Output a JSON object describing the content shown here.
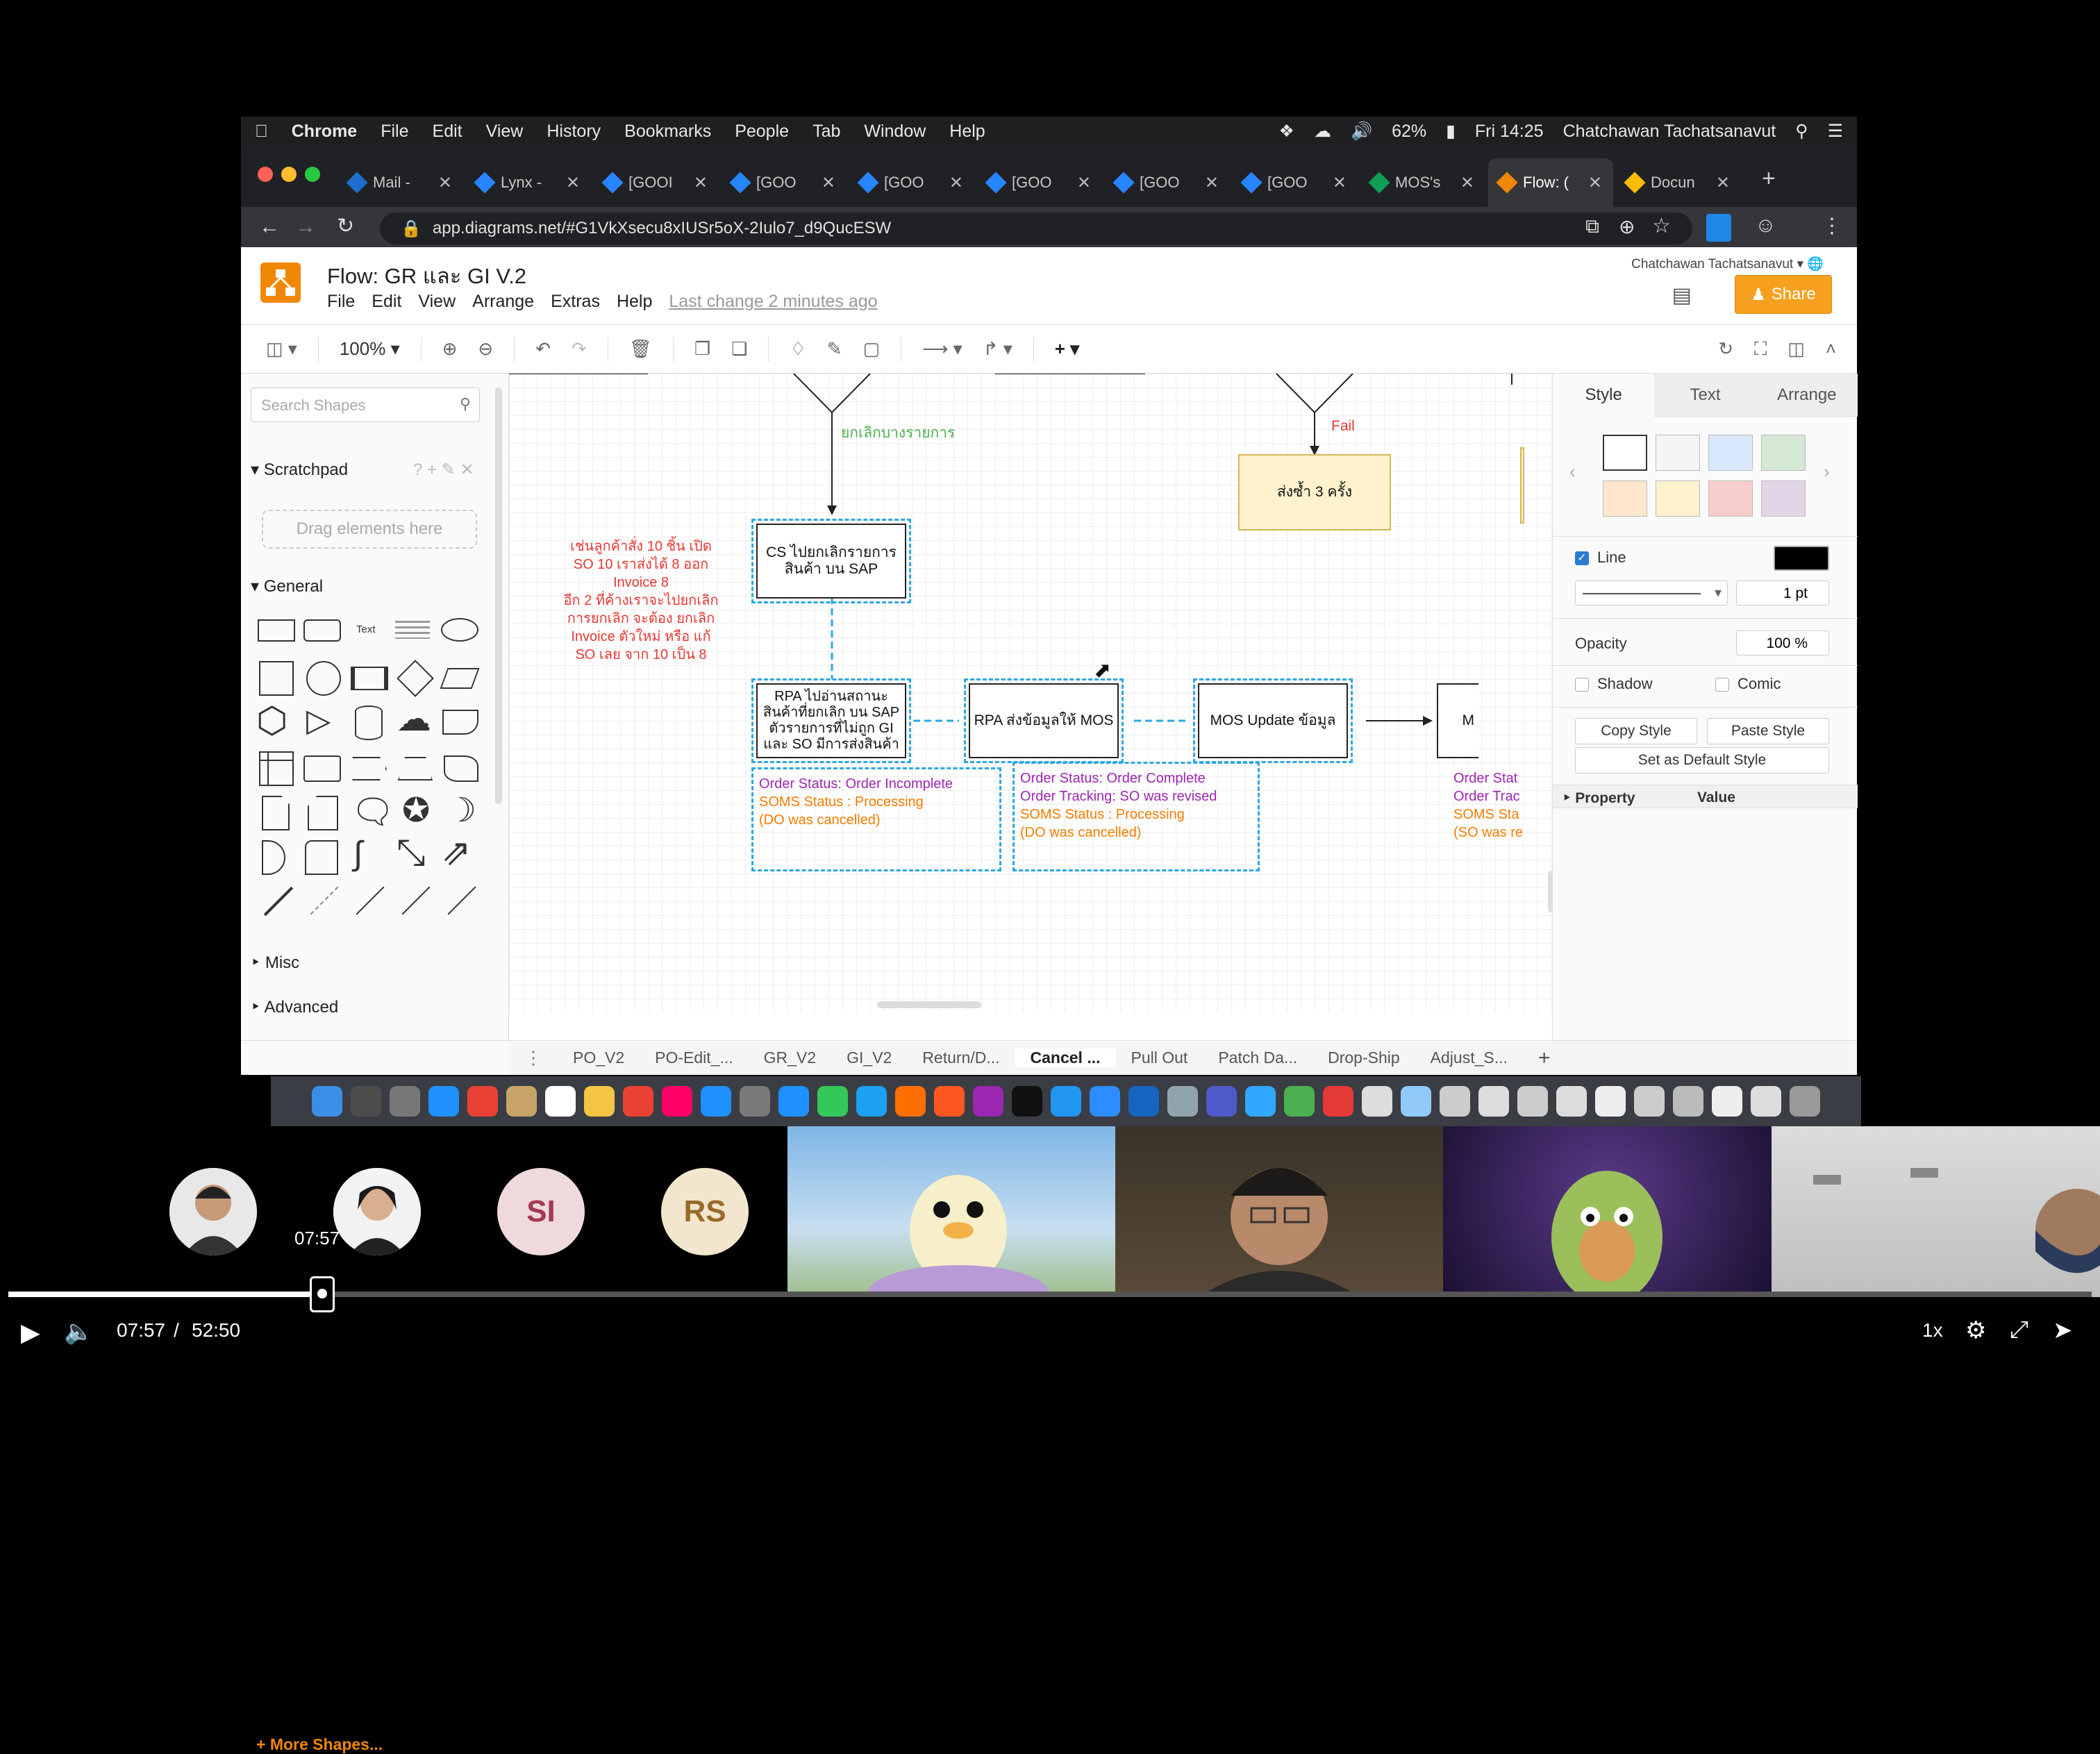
{
  "macbar": {
    "app": "Chrome",
    "menus": [
      "File",
      "Edit",
      "View",
      "History",
      "Bookmarks",
      "People",
      "Tab",
      "Window",
      "Help"
    ],
    "battery": "62%",
    "clock": "Fri 14:25",
    "user": "Chatchawan Tachatsanavut"
  },
  "browser": {
    "tabs": [
      {
        "label": "Mail - ",
        "icon": "outlook-icon",
        "color": "#1e6ecb"
      },
      {
        "label": "Lynx -",
        "icon": "jira-icon",
        "color": "#2684ff"
      },
      {
        "label": "[GOOI",
        "icon": "jira-icon",
        "color": "#2684ff"
      },
      {
        "label": "[GOO",
        "icon": "jira-icon",
        "color": "#2684ff"
      },
      {
        "label": "[GOO",
        "icon": "jira-icon",
        "color": "#2684ff"
      },
      {
        "label": "[GOO",
        "icon": "jira-icon",
        "color": "#2684ff"
      },
      {
        "label": "[GOO",
        "icon": "jira-icon",
        "color": "#2684ff"
      },
      {
        "label": "[GOO",
        "icon": "jira-icon",
        "color": "#2684ff"
      },
      {
        "label": "MOS's",
        "icon": "sheets-icon",
        "color": "#0f9d58"
      },
      {
        "label": "Flow: (",
        "icon": "drawio-icon",
        "color": "#f08705"
      },
      {
        "label": "Docun",
        "icon": "drive-icon",
        "color": "#fbbc04"
      }
    ],
    "active_tab_index": 9,
    "url": "app.diagrams.net/#G1VkXsecu8xIUSr5oX-2Iulo7_d9QucESW"
  },
  "app": {
    "title": "Flow: GR และ GI V.2",
    "menu": [
      "File",
      "Edit",
      "View",
      "Arrange",
      "Extras",
      "Help"
    ],
    "last_change": "Last change 2 minutes ago",
    "user": "Chatchawan Tachatsanavut",
    "share_label": "Share",
    "zoom": "100%"
  },
  "sidebar": {
    "search_placeholder": "Search Shapes",
    "scratchpad": "Scratchpad",
    "drag_hint": "Drag elements here",
    "general": "General",
    "misc": "Misc",
    "advanced": "Advanced",
    "more_shapes": "+ More Shapes..."
  },
  "canvas": {
    "edge_label_top": "ยกเลิกบางรายการ",
    "fail_label": "Fail",
    "resend_box": "ส่งซ้ำ 3 ครั้ง",
    "note_red": [
      "เช่นลูกค้าสั่ง 10 ชิ้น เปิด",
      "SO 10 เราส่งได้ 8 ออก",
      "Invoice 8",
      "อีก 2 ที่ค้างเราจะไปยกเลิก",
      "การยกเลิก จะต้อง ยกเลิก",
      "Invoice ตัวใหม่ หรือ แก้",
      "SO เลย จาก 10 เป็น 8"
    ],
    "box_cs": "CS ไปยกเลิกรายการ สินค้า บน SAP",
    "box_rpa1": "RPA ไปอ่านสถานะ สินค้าที่ยกเลิก บน SAP ตัวรายการที่ไม่ถูก GI และ SO มีการส่งสินค้า",
    "box_rpa2": "RPA ส่งข้อมูลให้ MOS",
    "box_mos": "MOS Update ข้อมูล",
    "box_m": "M",
    "status1": {
      "a": "Order Status: Order Incomplete",
      "b": "SOMS Status : Processing",
      "c": "(DO was cancelled)"
    },
    "status2": {
      "a": "Order Status: Order Complete",
      "b": "Order Tracking: SO was revised",
      "c": "SOMS Status : Processing",
      "d": "(DO was cancelled)"
    },
    "status3": {
      "a": "Order Stat",
      "b": "Order Trac",
      "c": "SOMS Sta",
      "d": "(SO was re"
    }
  },
  "rpanel": {
    "tabs": [
      "Style",
      "Text",
      "Arrange"
    ],
    "swatches": [
      "#ffffff",
      "#f5f5f5",
      "#dae8fc",
      "#d5e8d4",
      "#ffe6cc",
      "#fff2cc",
      "#f8cecc",
      "#e1d5e7"
    ],
    "line_label": "Line",
    "line_width": "1 pt",
    "opacity_label": "Opacity",
    "opacity": "100 %",
    "shadow": "Shadow",
    "comic": "Comic",
    "copy_style": "Copy Style",
    "paste_style": "Paste Style",
    "default_style": "Set as Default Style",
    "property": "Property",
    "value": "Value"
  },
  "pages": [
    "PO_V2",
    "PO-Edit_...",
    "GR_V2",
    "GI_V2",
    "Return/D...",
    "Cancel ...",
    "Pull Out",
    "Patch Da...",
    "Drop-Ship",
    "Adjust_S..."
  ],
  "active_page_index": 5,
  "participants": [
    {
      "initials": "SI",
      "bg": "#f0d9dd",
      "fg": "#a23a52"
    },
    {
      "initials": "RS",
      "bg": "#f3e6cf",
      "fg": "#9a6a2a"
    }
  ],
  "player": {
    "current": "07:57",
    "total": "52:50",
    "separator": "/",
    "hover_time": "07:57",
    "speed": "1x",
    "progress_fraction": 0.151
  }
}
